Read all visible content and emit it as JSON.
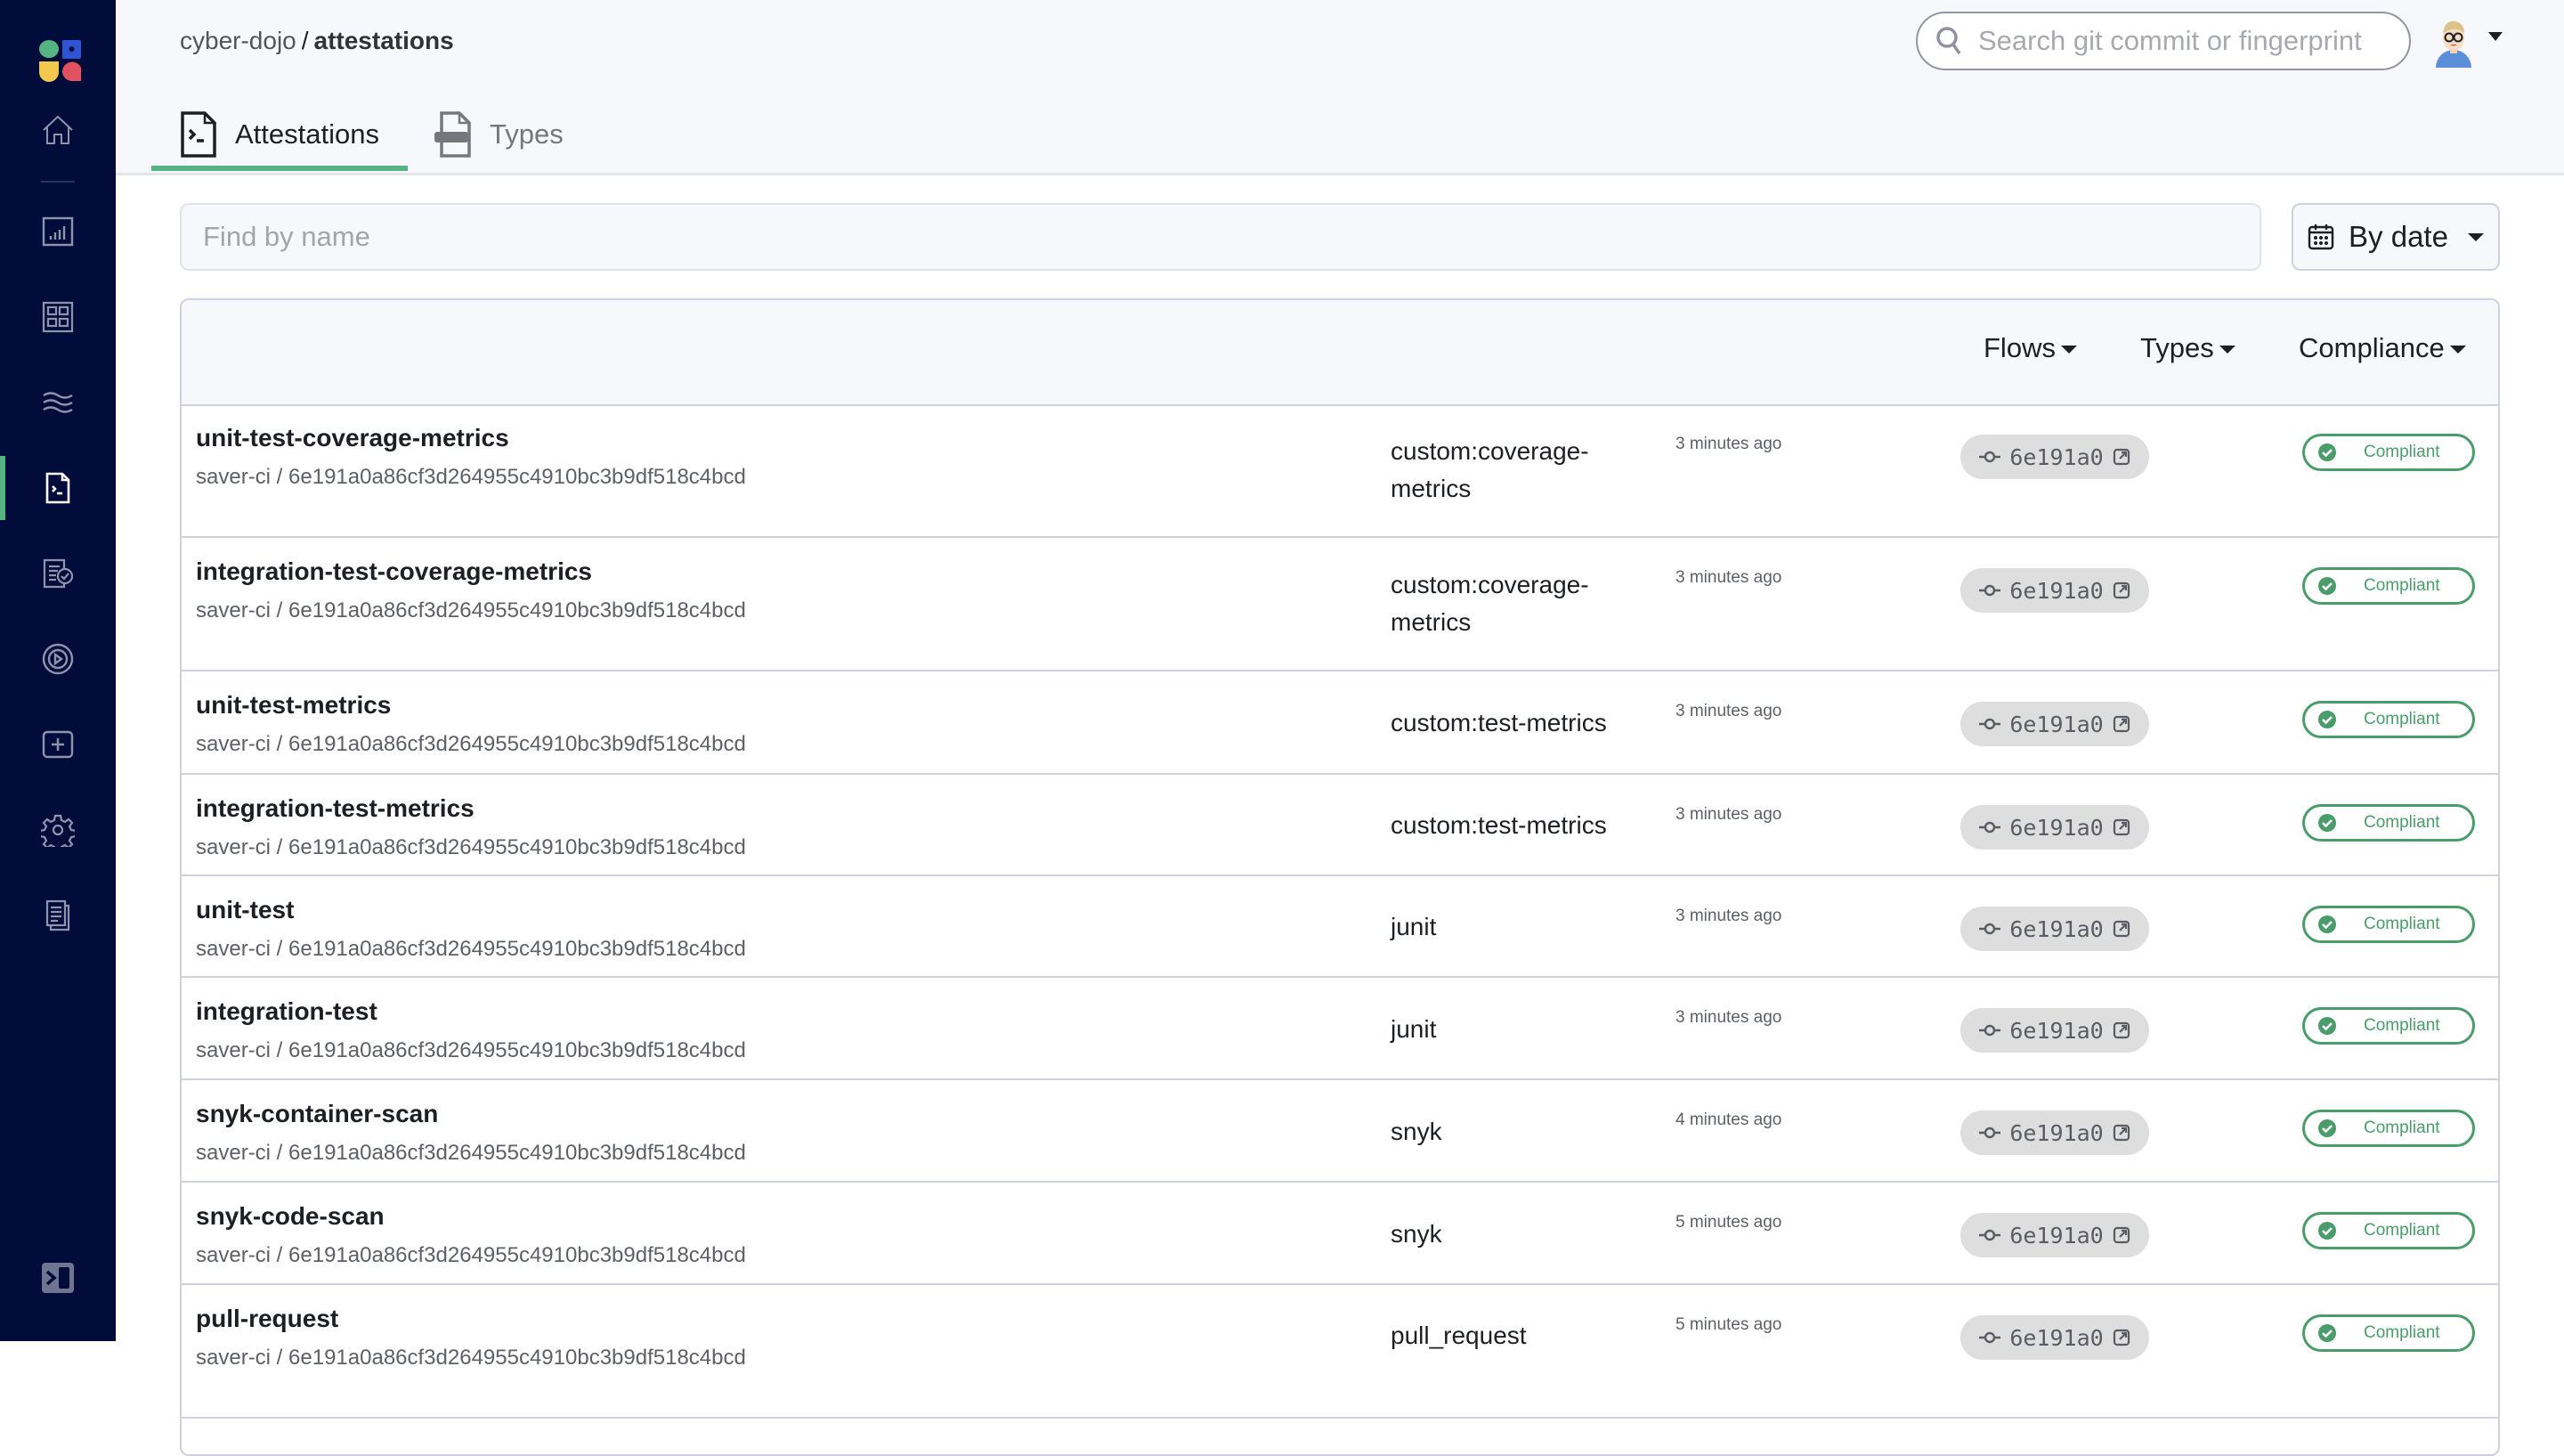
{
  "header": {
    "breadcrumb": {
      "org": "cyber-dojo",
      "separator": "/",
      "page": "attestations"
    },
    "search_placeholder": "Search git commit or fingerprint",
    "user_avatar": "avatar-cartoon"
  },
  "tabs": [
    {
      "label": "Attestations",
      "icon": "attestation-file-icon",
      "active": true
    },
    {
      "label": "Types",
      "icon": "types-file-icon",
      "active": false
    }
  ],
  "sidebar": {
    "items": [
      {
        "name": "home",
        "icon": "home-icon"
      },
      {
        "name": "reports",
        "icon": "bar-chart-icon"
      },
      {
        "name": "environments",
        "icon": "grid-icon"
      },
      {
        "name": "flows",
        "icon": "waves-icon"
      },
      {
        "name": "attestations",
        "icon": "attestation-icon",
        "active": true
      },
      {
        "name": "policies",
        "icon": "checklist-icon"
      },
      {
        "name": "artifacts",
        "icon": "target-icon"
      },
      {
        "name": "create",
        "icon": "plus-square-icon"
      },
      {
        "name": "settings",
        "icon": "gear-icon"
      },
      {
        "name": "docs",
        "icon": "documents-icon"
      }
    ],
    "collapse_icon": "sidebar-collapse-icon"
  },
  "filters": {
    "find_placeholder": "Find by name",
    "sort_label": "By date",
    "column_filters": [
      "Flows",
      "Types",
      "Compliance"
    ]
  },
  "colors": {
    "sidebar_bg": "#020c3a",
    "accent_green": "#56b483",
    "compliant_green": "#4a9d6a"
  },
  "attestations": [
    {
      "name": "unit-test-coverage-metrics",
      "flow": "saver-ci",
      "commit_full": "6e191a0a86cf3d264955c4910bc3b9df518c4bcd",
      "type": "custom:coverage-metrics",
      "time": "3 minutes ago",
      "commit_short": "6e191a0",
      "status": "Compliant"
    },
    {
      "name": "integration-test-coverage-metrics",
      "flow": "saver-ci",
      "commit_full": "6e191a0a86cf3d264955c4910bc3b9df518c4bcd",
      "type": "custom:coverage-metrics",
      "time": "3 minutes ago",
      "commit_short": "6e191a0",
      "status": "Compliant"
    },
    {
      "name": "unit-test-metrics",
      "flow": "saver-ci",
      "commit_full": "6e191a0a86cf3d264955c4910bc3b9df518c4bcd",
      "type": "custom:test-metrics",
      "time": "3 minutes ago",
      "commit_short": "6e191a0",
      "status": "Compliant"
    },
    {
      "name": "integration-test-metrics",
      "flow": "saver-ci",
      "commit_full": "6e191a0a86cf3d264955c4910bc3b9df518c4bcd",
      "type": "custom:test-metrics",
      "time": "3 minutes ago",
      "commit_short": "6e191a0",
      "status": "Compliant"
    },
    {
      "name": "unit-test",
      "flow": "saver-ci",
      "commit_full": "6e191a0a86cf3d264955c4910bc3b9df518c4bcd",
      "type": "junit",
      "time": "3 minutes ago",
      "commit_short": "6e191a0",
      "status": "Compliant"
    },
    {
      "name": "integration-test",
      "flow": "saver-ci",
      "commit_full": "6e191a0a86cf3d264955c4910bc3b9df518c4bcd",
      "type": "junit",
      "time": "3 minutes ago",
      "commit_short": "6e191a0",
      "status": "Compliant"
    },
    {
      "name": "snyk-container-scan",
      "flow": "saver-ci",
      "commit_full": "6e191a0a86cf3d264955c4910bc3b9df518c4bcd",
      "type": "snyk",
      "time": "4 minutes ago",
      "commit_short": "6e191a0",
      "status": "Compliant"
    },
    {
      "name": "snyk-code-scan",
      "flow": "saver-ci",
      "commit_full": "6e191a0a86cf3d264955c4910bc3b9df518c4bcd",
      "type": "snyk",
      "time": "5 minutes ago",
      "commit_short": "6e191a0",
      "status": "Compliant"
    },
    {
      "name": "pull-request",
      "flow": "saver-ci",
      "commit_full": "6e191a0a86cf3d264955c4910bc3b9df518c4bcd",
      "type": "pull_request",
      "time": "5 minutes ago",
      "commit_short": "6e191a0",
      "status": "Compliant"
    }
  ]
}
